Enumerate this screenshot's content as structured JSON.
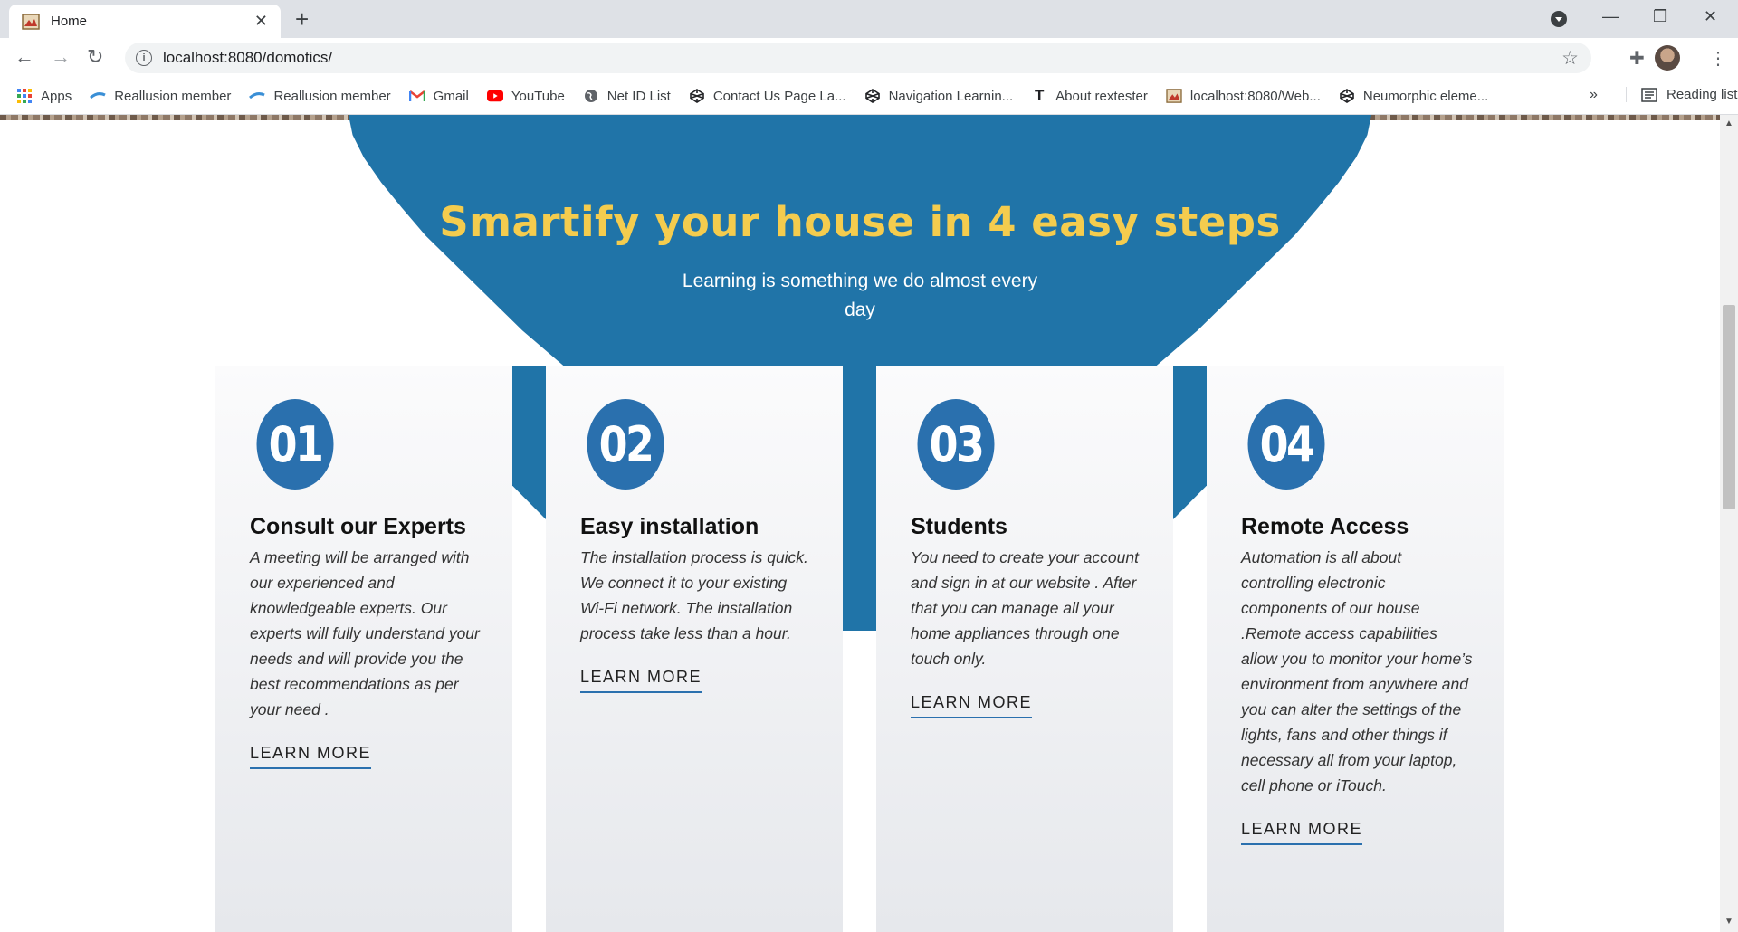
{
  "browser": {
    "tab_title": "Home",
    "url": "localhost:8080/domotics/",
    "bookmarks": [
      {
        "label": "Apps",
        "icon": "apps-grid-icon"
      },
      {
        "label": "Reallusion member",
        "icon": "reallusion-icon"
      },
      {
        "label": "Reallusion member",
        "icon": "reallusion-icon"
      },
      {
        "label": "Gmail",
        "icon": "gmail-icon"
      },
      {
        "label": "YouTube",
        "icon": "youtube-icon"
      },
      {
        "label": "Net ID List",
        "icon": "globe-icon"
      },
      {
        "label": "Contact Us Page La...",
        "icon": "codepen-icon"
      },
      {
        "label": "Navigation Learnin...",
        "icon": "codepen-icon"
      },
      {
        "label": "About rextester",
        "icon": "t-letter-icon"
      },
      {
        "label": "localhost:8080/Web...",
        "icon": "page-favicon-icon"
      },
      {
        "label": "Neumorphic eleme...",
        "icon": "codepen-icon"
      }
    ],
    "bookmarks_more": "»",
    "reading_list": "Reading list"
  },
  "hero": {
    "title": "Smartify your house in 4 easy steps",
    "subtitle": "Learning is something we do almost every day"
  },
  "steps": [
    {
      "number": "01",
      "title": "Consult our Experts",
      "text": "A meeting will be arranged with our experienced and knowledgeable experts. Our experts will fully understand your needs and will provide you the best recommendations as per your need .",
      "link": "LEARN MORE"
    },
    {
      "number": "02",
      "title": "Easy installation",
      "text": "The installation process is quick. We connect it to your existing Wi-Fi network. The installation process take less than a hour.",
      "link": "LEARN MORE"
    },
    {
      "number": "03",
      "title": "Students",
      "text": "You need to create your account and sign in at our website . After that you can manage all your home appliances through one touch only.",
      "link": "LEARN MORE"
    },
    {
      "number": "04",
      "title": "Remote Access",
      "text": "Automation is all about controlling electronic components of our house .Remote access capabilities allow you to monitor your home’s environment from anywhere and you can alter the settings of the lights, fans and other things if necessary all from your laptop, cell phone or iTouch.",
      "link": "LEARN MORE"
    }
  ],
  "colors": {
    "hero_blue": "#2074a8",
    "title_yellow": "#f4cc4e",
    "circle_blue": "#2a70ae"
  }
}
